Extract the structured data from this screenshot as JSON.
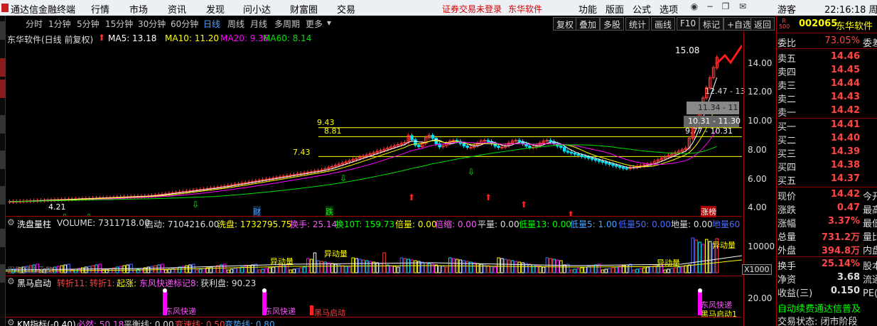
{
  "app": {
    "title": "通达信金融终端",
    "menus": [
      "行情",
      "市场",
      "资讯",
      "发现",
      "问小达",
      "财富圈",
      "交易"
    ],
    "notice1": "证券交易未登录",
    "notice2": "东华软件",
    "right_menus": [
      "功能",
      "版面",
      "公式",
      "选项"
    ],
    "user": "游客",
    "time": "22:16:18 周"
  },
  "toolbar": {
    "periods": [
      "分时",
      "1分钟",
      "5分钟",
      "15分钟",
      "30分钟",
      "60分钟",
      "日线",
      "周线",
      "月线",
      "多周期",
      "更多"
    ],
    "active": "日线",
    "buttons": [
      "复权",
      "叠加",
      "多股",
      "统计",
      "画线",
      "F10",
      "标记",
      "+自选",
      "返回"
    ]
  },
  "chart_header": {
    "name": "东华软件(日线 前复权)",
    "ma5": "MA5: 13.18",
    "ma10": "MA10: 11.20",
    "ma20": "MA20: 9.36",
    "ma60": "MA60: 8.14"
  },
  "chart_labels": {
    "high": "15.08",
    "low": "4.21",
    "l943": "9.43",
    "l881": "8.81",
    "l743": "7.43",
    "box1": "12.47 - 13",
    "box2": "11.34 - 11",
    "box3": "10.31 - 11.30",
    "box4": "9.77 - 10.31",
    "marker_cai": "财",
    "marker_die": "跌",
    "marker_zhang": "涨榜"
  },
  "axis": {
    "ticks": [
      "14.00",
      "12.00",
      "10.00",
      "8.00",
      "6.00",
      "4.00"
    ],
    "vol_ticks": [
      "10000"
    ],
    "vol_unit": "X1000",
    "ind_tick": "20.00"
  },
  "volume_header": {
    "name": "洗盘量柱",
    "volume": "VOLUME: 7311718.00",
    "qidong": "启动: 7104216.00",
    "xipan": "洗盘: 1732795.75",
    "huanshou": "换手: 25.14",
    "huan10t": "换10T: 159.73",
    "beiliang": "倍量: 0.00",
    "beisuo": "倍缩: 0.00",
    "pingliang": "平量: 0.00",
    "diliang13": "低量13: 0.00",
    "diliang5": "低量5: 1.00",
    "diliang50": "低量50: 0.00",
    "diliang": "地量: 0.00",
    "diliang60": "地量60",
    "tag": "异动量",
    "dll": "用到DLL函数"
  },
  "ind_header": {
    "name": "黑马启动",
    "zhe11": "转折11:",
    "zhe1": "转折1:",
    "qizhang": "起涨:",
    "dongfeng": "东风快递标记8:",
    "huolipan": "获利盘: 90.23",
    "tag1": "东风快递",
    "tag2": "黑马启动",
    "tag3": "黑马启动1"
  },
  "km_header": {
    "name": "KM指标(-0.40)",
    "biran": "必然: 50.18",
    "pingheng": "平衡线: 0.00",
    "bianshu": "变速线: 0.50",
    "bianshi": "变势线: 0.80"
  },
  "quote": {
    "code": "002065",
    "name": "东华软件",
    "weibi_label": "委比",
    "weibi": "73.05%",
    "weibi_tail": "委差",
    "asks": [
      {
        "label": "卖五",
        "price": "14.46"
      },
      {
        "label": "卖四",
        "price": "14.45"
      },
      {
        "label": "卖三",
        "price": "14.44"
      },
      {
        "label": "卖二",
        "price": "14.43"
      },
      {
        "label": "卖一",
        "price": "14.42"
      }
    ],
    "bids": [
      {
        "label": "买一",
        "price": "14.41"
      },
      {
        "label": "买二",
        "price": "14.40"
      },
      {
        "label": "买三",
        "price": "14.39"
      },
      {
        "label": "买四",
        "price": "14.38"
      },
      {
        "label": "买五",
        "price": "14.37"
      }
    ],
    "stats": [
      {
        "label": "现价",
        "value": "14.42",
        "tail": "今开"
      },
      {
        "label": "涨跌",
        "value": "0.47",
        "tail": "最高"
      },
      {
        "label": "涨幅",
        "value": "3.37%",
        "tail": "最低"
      },
      {
        "label": "总量",
        "value": "731.2万",
        "tail": "量比"
      },
      {
        "label": "外盘",
        "value": "394.8万",
        "tail": "内盘"
      }
    ],
    "stats2": [
      {
        "label": "换手",
        "value": "25.14%",
        "tail": "股本"
      },
      {
        "label": "净资",
        "value": "3.68",
        "tail": "流通"
      },
      {
        "label": "收益(三)",
        "value": "0.150",
        "tail": "PE(动"
      }
    ],
    "promo": "自动续费通达信普及",
    "status": "交易状态: 闭市阶段",
    "r500": "R\n500"
  },
  "colors": {
    "up": "#ff3b3b",
    "down": "#00e5ff",
    "ma5": "#ffffff",
    "ma10": "#ffff00",
    "ma20": "#ff00ff",
    "ma60": "#00e000"
  }
}
